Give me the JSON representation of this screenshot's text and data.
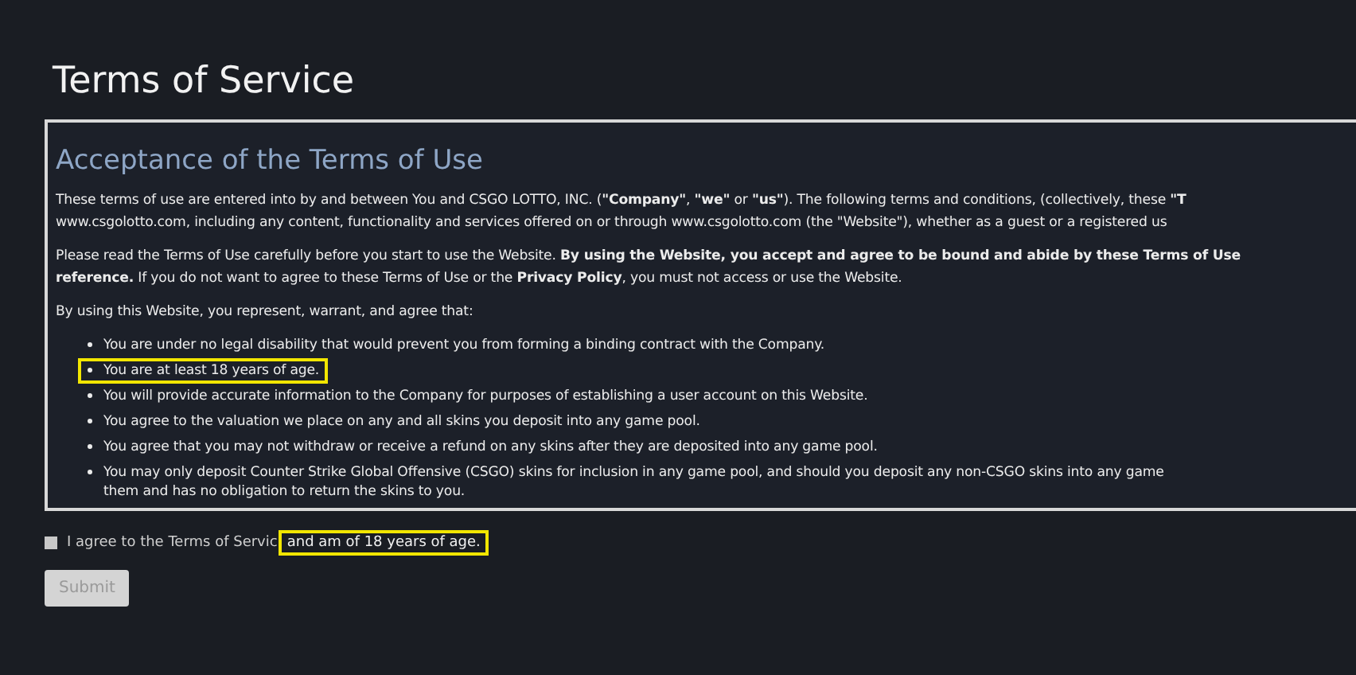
{
  "title": "Terms of Service",
  "section": {
    "heading": "Acceptance of the Terms of Use",
    "paragraphs": [
      {
        "lines": [
          "These terms of use are entered into by and between You and CSGO LOTTO, INC. (**\"Company\"**, **\"we\"** or **\"us\"**). The following terms and conditions, (collectively, these **\"T**",
          "www.csgolotto.com, including any content, functionality and services offered on or through www.csgolotto.com (the \"Website\"), whether as a guest or a registered us"
        ]
      },
      {
        "lines": [
          "Please read the Terms of Use carefully before you start to use the Website. **By using the Website, you accept and agree to be bound and abide by these Terms of Use**",
          "**reference.** If you do not want to agree to these Terms of Use or the **Privacy Policy**, you must not access or use the Website."
        ]
      },
      {
        "lines": [
          "By using this Website, you represent, warrant, and agree that:"
        ]
      }
    ],
    "bullets": [
      {
        "lines": [
          "You are under no legal disability that would prevent you from forming a binding contract with the Company."
        ],
        "highlighted": false
      },
      {
        "lines": [
          "You are at least 18 years of age."
        ],
        "highlighted": true
      },
      {
        "lines": [
          "You will provide accurate information to the Company for purposes of establishing a user account on this Website."
        ],
        "highlighted": false
      },
      {
        "lines": [
          "You agree to the valuation we place on any and all skins you deposit into any game pool."
        ],
        "highlighted": false
      },
      {
        "lines": [
          "You agree that you may not withdraw or receive a refund on any skins after they are deposited into any game pool."
        ],
        "highlighted": false
      },
      {
        "lines": [
          "You may only deposit Counter Strike Global Offensive (CSGO) skins for inclusion in any game pool, and should you deposit any non-CSGO skins into any game",
          "them and has no obligation to return the skins to you."
        ],
        "highlighted": false
      }
    ]
  },
  "agree": {
    "checked": false,
    "label": "I agree to the Terms of Servic",
    "highlighted_label": "and am of 18 years of age."
  },
  "submit": {
    "label": "Submit",
    "disabled": true
  }
}
